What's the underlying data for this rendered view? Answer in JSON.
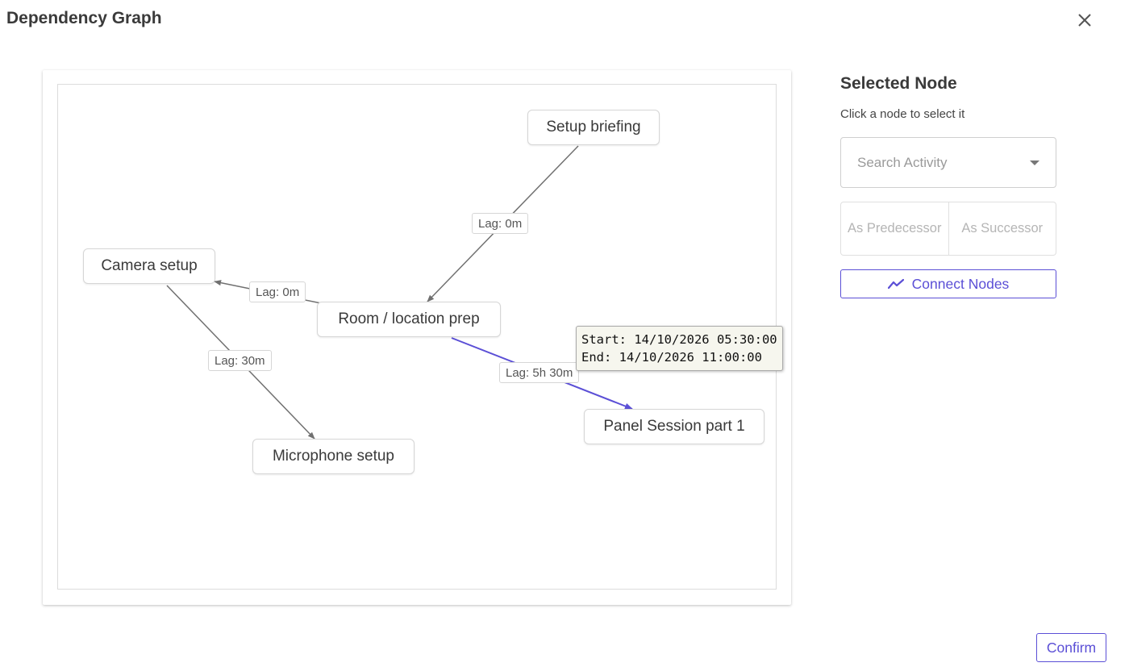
{
  "dialog": {
    "title": "Dependency Graph"
  },
  "graph": {
    "nodes": [
      {
        "id": "setup_briefing",
        "label": "Setup briefing"
      },
      {
        "id": "camera_setup",
        "label": "Camera setup"
      },
      {
        "id": "room_prep",
        "label": "Room / location prep"
      },
      {
        "id": "panel_session",
        "label": "Panel Session part 1"
      },
      {
        "id": "microphone_setup",
        "label": "Microphone setup"
      }
    ],
    "edges": [
      {
        "from": "Setup briefing",
        "to": "Room / location prep",
        "lag": "Lag: 0m",
        "highlighted": false
      },
      {
        "from": "Room / location prep",
        "to": "Camera setup",
        "lag": "Lag: 0m",
        "highlighted": false
      },
      {
        "from": "Camera setup",
        "to": "Microphone setup",
        "lag": "Lag: 30m",
        "highlighted": false
      },
      {
        "from": "Room / location prep",
        "to": "Panel Session part 1",
        "lag": "Lag: 5h 30m",
        "highlighted": true
      }
    ],
    "tooltip": {
      "start": "Start: 14/10/2026 05:30:00",
      "end": "End: 14/10/2026 11:00:00"
    },
    "colors": {
      "edge": "#707070",
      "highlight": "#5b4fd6"
    }
  },
  "panel": {
    "title": "Selected Node",
    "hint": "Click a node to select it",
    "search_placeholder": "Search Activity",
    "as_predecessor": "As Predecessor",
    "as_successor": "As Successor",
    "connect_label": "Connect Nodes"
  },
  "footer": {
    "confirm_label": "Confirm"
  },
  "colors": {
    "accent": "#5b4fd6"
  },
  "icons": {
    "close": "close-icon",
    "dropdown": "chevron-down-icon",
    "connect": "connect-nodes-icon"
  }
}
